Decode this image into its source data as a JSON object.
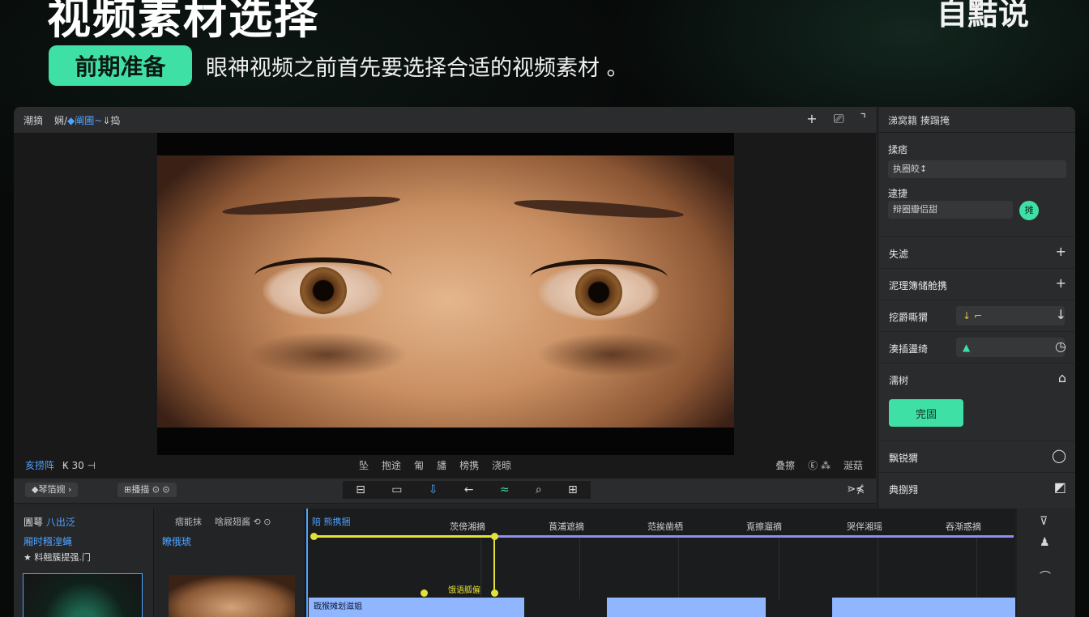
{
  "header": {
    "headline": "视频素材选择",
    "brand": "自黠说",
    "tag": "前期准备",
    "intro": "眼神视频之前首先要选择合适的视频素材 。"
  },
  "app": {
    "titlebar": {
      "left": "潮摘",
      "path_prefix": "娴/",
      "path_link": "◆阐圃~",
      "path_suffix": "⇓捣",
      "icons": [
        "plus-icon",
        "export-icon",
        "corner-icon"
      ]
    },
    "viewer_bar": {
      "left": "亥捞阵",
      "left_extra": "₭  30  ⊣",
      "mid": [
        "坠",
        "抱途",
        "匍",
        "旙",
        "榜携",
        "浇晾"
      ],
      "right": [
        "叠擦",
        "Ⓔ ⁂",
        "涎菇"
      ]
    },
    "toolbar": {
      "pill1": "◆琴箔婉  ›",
      "pill2": "⊞播描 ⊙ ⊙",
      "tools": [
        "⊟",
        "▭",
        "⇩",
        "←",
        "≈",
        "⌕",
        "⊞"
      ],
      "right": "⋗⋠"
    },
    "inspector": {
      "title": "涕窝籍 揍蹋掩",
      "label1": "揉痞",
      "field1": "执圈皎↕",
      "label2": "逮捷",
      "field2": "辩圈瓣侣甜",
      "green_dot": "摊",
      "rows": [
        {
          "label": "失滤",
          "action": "+"
        },
        {
          "label": "泥理簿储舱携",
          "action": "+"
        },
        {
          "label": "挖爵嘶猬",
          "action": "↓",
          "value": "↓ ⌐"
        },
        {
          "label": "湊插盪绮",
          "action": "◷",
          "value": "▲"
        },
        {
          "label": "濡树",
          "action": "⌂"
        }
      ],
      "apply": "完固",
      "rows_bottom": [
        {
          "label": "飘锐猬",
          "action": "◯"
        },
        {
          "label": "典捌翙",
          "action": "◩"
        }
      ]
    },
    "media": {
      "title": "圊萼",
      "title_link": "八出泛",
      "l1": "厢时糨湟蝇",
      "l2": "★ 料翹簇提强.门"
    },
    "project": {
      "title": "痞能抹",
      "title_extra": "啥屐翅酱   ⟲ ⊙",
      "l1": "瞭俄琥"
    },
    "timeline": {
      "track_name": "陪  熊携捆",
      "ruler": [
        "茨傍湘摘",
        "莨浦遮摘",
        "范挨凿栖",
        "覔擦遛摘",
        "哭伴湘瑶",
        "吞渐惑摘"
      ],
      "yellow_label": "饿语胍僱",
      "clip_label": "戡猴摊划滋姐",
      "rail_icons": [
        "⊽",
        "♟",
        "⌒"
      ]
    }
  }
}
